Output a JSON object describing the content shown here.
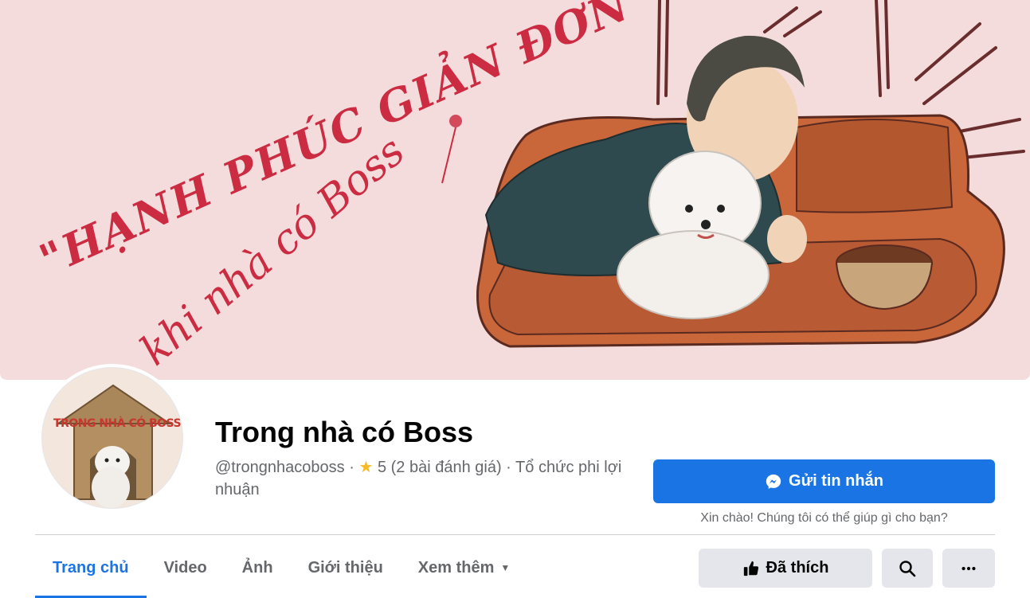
{
  "cover": {
    "caption_line1": "\"HẠNH PHÚC GIẢN ĐƠN",
    "caption_line2": "khi nhà có Boss"
  },
  "avatar": {
    "logo_text": "TRONG NHÀ CÓ BOSS"
  },
  "page": {
    "name": "Trong nhà có Boss",
    "handle": "@trongnhacoboss",
    "separator": "·",
    "rating": "5 (2 bài đánh giá)",
    "category": "Tổ chức phi lợi nhuận"
  },
  "message": {
    "button_label": "Gửi tin nhắn",
    "hint": "Xin chào! Chúng tôi có thể giúp gì cho bạn?"
  },
  "tabs": [
    {
      "label": "Trang chủ",
      "active": true
    },
    {
      "label": "Video",
      "active": false
    },
    {
      "label": "Ảnh",
      "active": false
    },
    {
      "label": "Giới thiệu",
      "active": false
    },
    {
      "label": "Xem thêm",
      "active": false
    }
  ],
  "actions": {
    "liked_label": "Đã thích"
  },
  "colors": {
    "accent": "#1b74e4",
    "cover_bg": "#f4dcdd",
    "caption": "#cc2c42"
  }
}
